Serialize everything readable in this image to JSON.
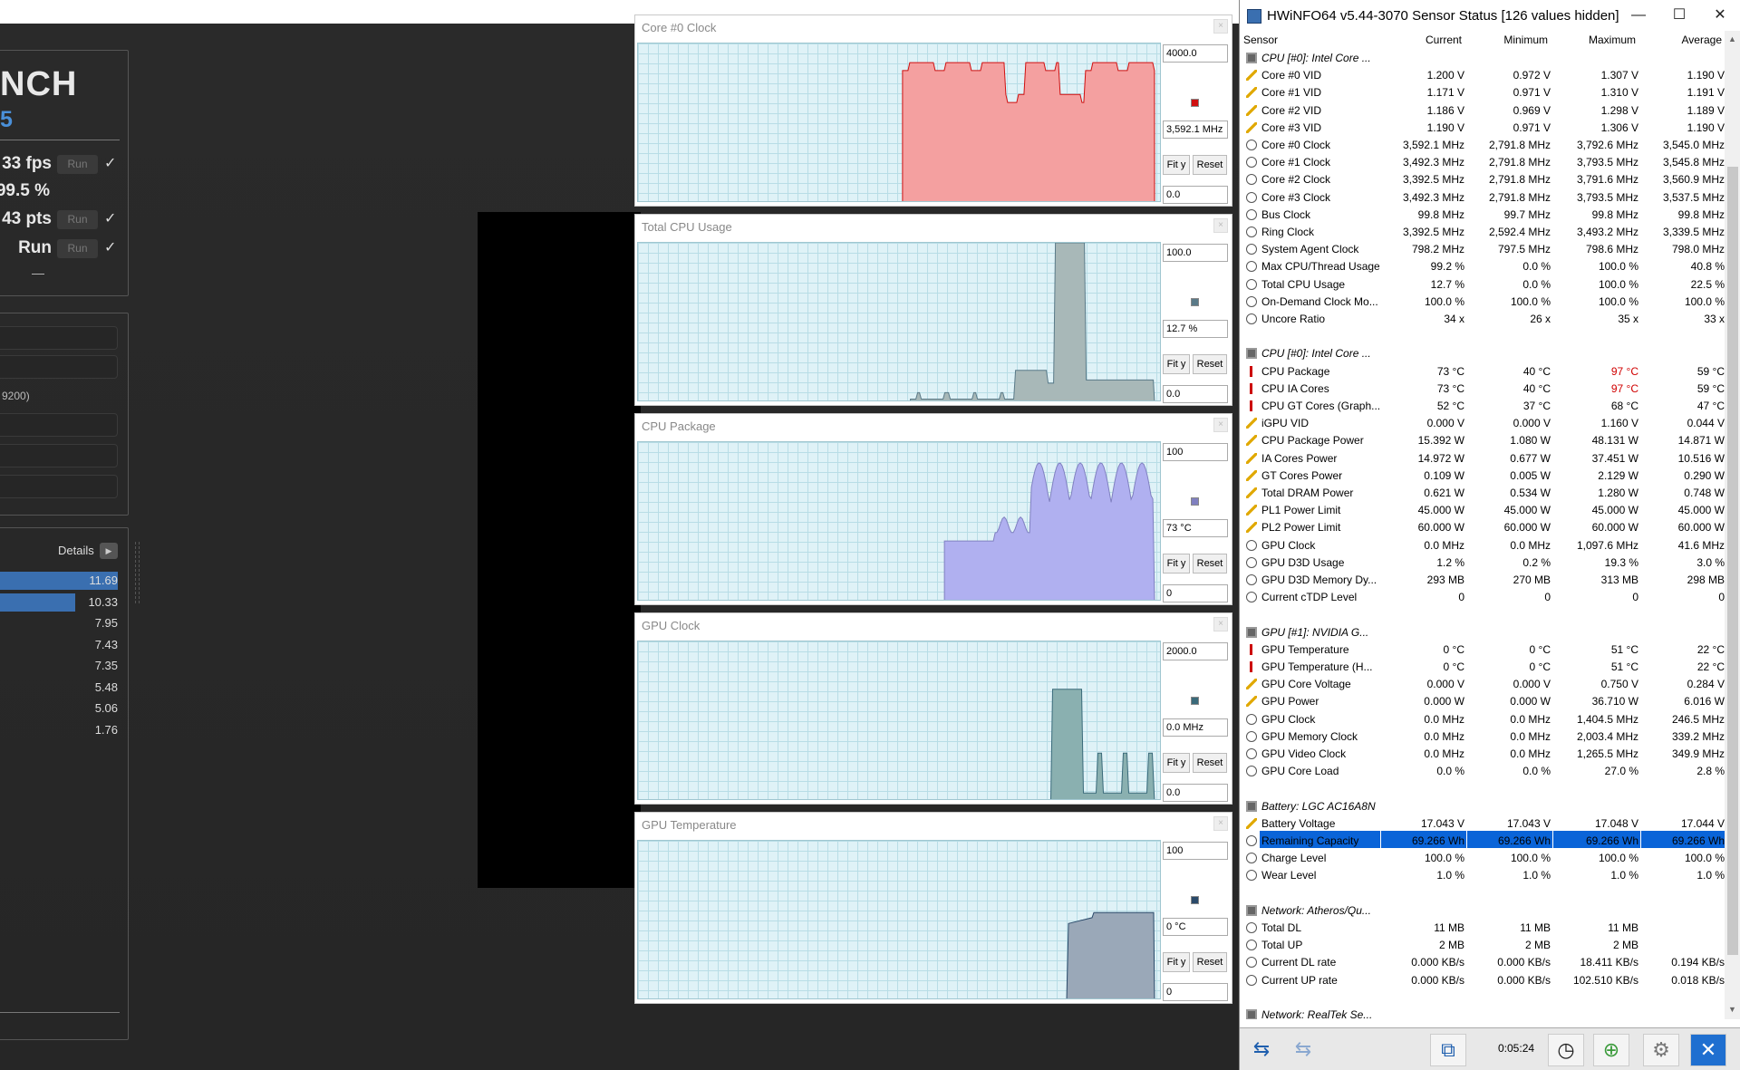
{
  "cinebench": {
    "title": "NCH",
    "subtitle": "5",
    "rows": [
      {
        "value": "33 fps",
        "run": "Run",
        "check": "✓"
      },
      {
        "value": "99.5 %",
        "run": "",
        "check": ""
      },
      {
        "value": "43 pts",
        "run": "Run",
        "check": "✓"
      },
      {
        "value": "Run",
        "run": "Run",
        "check": "✓"
      }
    ],
    "dash": "—",
    "inputs": [
      "",
      "",
      "9200)",
      "",
      "",
      ""
    ],
    "details_label": "Details",
    "ranking": [
      "11.69",
      "10.33",
      "7.95",
      "7.43",
      "7.35",
      "5.48",
      "5.06",
      "1.76"
    ],
    "ranking_fill": [
      1.0,
      0.64,
      0,
      0,
      0,
      0,
      0,
      0
    ]
  },
  "graphs": [
    {
      "title": "Core #0 Clock",
      "max": "4000.0",
      "current": "3,592.1 MHz",
      "min": "0.0",
      "color": "#f4a0a0",
      "marker": "#d01010",
      "fit": "Fit y",
      "reset": "Reset"
    },
    {
      "title": "Total CPU Usage",
      "max": "100.0",
      "current": "12.7 %",
      "min": "0.0",
      "color": "#a8b8b8",
      "marker": "#5a7a88",
      "fit": "Fit y",
      "reset": "Reset"
    },
    {
      "title": "CPU Package",
      "max": "100",
      "current": "73 °C",
      "min": "0",
      "color": "#b0b0f0",
      "marker": "#8080c0",
      "fit": "Fit y",
      "reset": "Reset"
    },
    {
      "title": "GPU Clock",
      "max": "2000.0",
      "current": "0.0 MHz",
      "min": "0.0",
      "color": "#8ab0b0",
      "marker": "#3a6a7a",
      "fit": "Fit y",
      "reset": "Reset"
    },
    {
      "title": "GPU Temperature",
      "max": "100",
      "current": "0 °C",
      "min": "0",
      "color": "#9aa8b8",
      "marker": "#2a4a6a",
      "fit": "Fit y",
      "reset": "Reset"
    }
  ],
  "hwinfo": {
    "title": "HWiNFO64 v5.44-3070 Sensor Status [126 values hidden]",
    "controls": {
      "minimize": "—",
      "maximize": "☐",
      "close": "✕"
    },
    "headers": [
      "Sensor",
      "Current",
      "Minimum",
      "Maximum",
      "Average"
    ],
    "rows": [
      {
        "t": "chip",
        "g": 1,
        "n": "CPU [#0]: Intel Core ...",
        "v": [
          "",
          "",
          "",
          ""
        ]
      },
      {
        "t": "volt",
        "n": "Core #0 VID",
        "v": [
          "1.200 V",
          "0.972 V",
          "1.307 V",
          "1.190 V"
        ]
      },
      {
        "t": "volt",
        "n": "Core #1 VID",
        "v": [
          "1.171 V",
          "0.971 V",
          "1.310 V",
          "1.191 V"
        ]
      },
      {
        "t": "volt",
        "n": "Core #2 VID",
        "v": [
          "1.186 V",
          "0.969 V",
          "1.298 V",
          "1.189 V"
        ]
      },
      {
        "t": "volt",
        "n": "Core #3 VID",
        "v": [
          "1.190 V",
          "0.971 V",
          "1.306 V",
          "1.190 V"
        ]
      },
      {
        "t": "clock",
        "n": "Core #0 Clock",
        "v": [
          "3,592.1 MHz",
          "2,791.8 MHz",
          "3,792.6 MHz",
          "3,545.0 MHz"
        ]
      },
      {
        "t": "clock",
        "n": "Core #1 Clock",
        "v": [
          "3,492.3 MHz",
          "2,791.8 MHz",
          "3,793.5 MHz",
          "3,545.8 MHz"
        ]
      },
      {
        "t": "clock",
        "n": "Core #2 Clock",
        "v": [
          "3,392.5 MHz",
          "2,791.8 MHz",
          "3,791.6 MHz",
          "3,560.9 MHz"
        ]
      },
      {
        "t": "clock",
        "n": "Core #3 Clock",
        "v": [
          "3,492.3 MHz",
          "2,791.8 MHz",
          "3,793.5 MHz",
          "3,537.5 MHz"
        ]
      },
      {
        "t": "clock",
        "n": "Bus Clock",
        "v": [
          "99.8 MHz",
          "99.7 MHz",
          "99.8 MHz",
          "99.8 MHz"
        ]
      },
      {
        "t": "clock",
        "n": "Ring Clock",
        "v": [
          "3,392.5 MHz",
          "2,592.4 MHz",
          "3,493.2 MHz",
          "3,339.5 MHz"
        ]
      },
      {
        "t": "clock",
        "n": "System Agent Clock",
        "v": [
          "798.2 MHz",
          "797.5 MHz",
          "798.6 MHz",
          "798.0 MHz"
        ]
      },
      {
        "t": "clock",
        "n": "Max CPU/Thread Usage",
        "v": [
          "99.2 %",
          "0.0 %",
          "100.0 %",
          "40.8 %"
        ]
      },
      {
        "t": "clock",
        "n": "Total CPU Usage",
        "v": [
          "12.7 %",
          "0.0 %",
          "100.0 %",
          "22.5 %"
        ]
      },
      {
        "t": "clock",
        "n": "On-Demand Clock Mo...",
        "v": [
          "100.0 %",
          "100.0 %",
          "100.0 %",
          "100.0 %"
        ]
      },
      {
        "t": "clock",
        "n": "Uncore Ratio",
        "v": [
          "34 x",
          "26 x",
          "35 x",
          "33 x"
        ]
      },
      {
        "t": "",
        "n": "",
        "v": [
          "",
          "",
          "",
          ""
        ]
      },
      {
        "t": "chip",
        "g": 1,
        "n": "CPU [#0]: Intel Core ...",
        "v": [
          "",
          "",
          "",
          ""
        ]
      },
      {
        "t": "temp",
        "n": "CPU Package",
        "v": [
          "73 °C",
          "40 °C",
          "97 °C",
          "59 °C"
        ],
        "r": 2
      },
      {
        "t": "temp",
        "n": "CPU IA Cores",
        "v": [
          "73 °C",
          "40 °C",
          "97 °C",
          "59 °C"
        ],
        "r": 2
      },
      {
        "t": "temp",
        "n": "CPU GT Cores (Graph...",
        "v": [
          "52 °C",
          "37 °C",
          "68 °C",
          "47 °C"
        ]
      },
      {
        "t": "volt",
        "n": "iGPU VID",
        "v": [
          "0.000 V",
          "0.000 V",
          "1.160 V",
          "0.044 V"
        ]
      },
      {
        "t": "volt",
        "n": "CPU Package Power",
        "v": [
          "15.392 W",
          "1.080 W",
          "48.131 W",
          "14.871 W"
        ]
      },
      {
        "t": "volt",
        "n": "IA Cores Power",
        "v": [
          "14.972 W",
          "0.677 W",
          "37.451 W",
          "10.516 W"
        ]
      },
      {
        "t": "volt",
        "n": "GT Cores Power",
        "v": [
          "0.109 W",
          "0.005 W",
          "2.129 W",
          "0.290 W"
        ]
      },
      {
        "t": "volt",
        "n": "Total DRAM Power",
        "v": [
          "0.621 W",
          "0.534 W",
          "1.280 W",
          "0.748 W"
        ]
      },
      {
        "t": "volt",
        "n": "PL1 Power Limit",
        "v": [
          "45.000 W",
          "45.000 W",
          "45.000 W",
          "45.000 W"
        ]
      },
      {
        "t": "volt",
        "n": "PL2 Power Limit",
        "v": [
          "60.000 W",
          "60.000 W",
          "60.000 W",
          "60.000 W"
        ]
      },
      {
        "t": "clock",
        "n": "GPU Clock",
        "v": [
          "0.0 MHz",
          "0.0 MHz",
          "1,097.6 MHz",
          "41.6 MHz"
        ]
      },
      {
        "t": "clock",
        "n": "GPU D3D Usage",
        "v": [
          "1.2 %",
          "0.2 %",
          "19.3 %",
          "3.0 %"
        ]
      },
      {
        "t": "clock",
        "n": "GPU D3D Memory Dy...",
        "v": [
          "293 MB",
          "270 MB",
          "313 MB",
          "298 MB"
        ]
      },
      {
        "t": "clock",
        "n": "Current cTDP Level",
        "v": [
          "0",
          "0",
          "0",
          "0"
        ]
      },
      {
        "t": "",
        "n": "",
        "v": [
          "",
          "",
          "",
          ""
        ]
      },
      {
        "t": "chip",
        "g": 1,
        "n": "GPU [#1]: NVIDIA G...",
        "v": [
          "",
          "",
          "",
          ""
        ]
      },
      {
        "t": "temp",
        "n": "GPU Temperature",
        "v": [
          "0 °C",
          "0 °C",
          "51 °C",
          "22 °C"
        ]
      },
      {
        "t": "temp",
        "n": "GPU Temperature (H...",
        "v": [
          "0 °C",
          "0 °C",
          "51 °C",
          "22 °C"
        ]
      },
      {
        "t": "volt",
        "n": "GPU Core Voltage",
        "v": [
          "0.000 V",
          "0.000 V",
          "0.750 V",
          "0.284 V"
        ]
      },
      {
        "t": "volt",
        "n": "GPU Power",
        "v": [
          "0.000 W",
          "0.000 W",
          "36.710 W",
          "6.016 W"
        ]
      },
      {
        "t": "clock",
        "n": "GPU Clock",
        "v": [
          "0.0 MHz",
          "0.0 MHz",
          "1,404.5 MHz",
          "246.5 MHz"
        ]
      },
      {
        "t": "clock",
        "n": "GPU Memory Clock",
        "v": [
          "0.0 MHz",
          "0.0 MHz",
          "2,003.4 MHz",
          "339.2 MHz"
        ]
      },
      {
        "t": "clock",
        "n": "GPU Video Clock",
        "v": [
          "0.0 MHz",
          "0.0 MHz",
          "1,265.5 MHz",
          "349.9 MHz"
        ]
      },
      {
        "t": "clock",
        "n": "GPU Core Load",
        "v": [
          "0.0 %",
          "0.0 %",
          "27.0 %",
          "2.8 %"
        ]
      },
      {
        "t": "",
        "n": "",
        "v": [
          "",
          "",
          "",
          ""
        ]
      },
      {
        "t": "chip",
        "g": 1,
        "n": "Battery: LGC AC16A8N",
        "v": [
          "",
          "",
          "",
          ""
        ]
      },
      {
        "t": "volt",
        "n": "Battery Voltage",
        "v": [
          "17.043 V",
          "17.043 V",
          "17.048 V",
          "17.044 V"
        ]
      },
      {
        "t": "clock",
        "n": "Remaining Capacity",
        "v": [
          "69.266 Wh",
          "69.266 Wh",
          "69.266 Wh",
          "69.266 Wh"
        ]
      },
      {
        "t": "clock",
        "n": "Charge Level",
        "v": [
          "100.0 %",
          "100.0 %",
          "100.0 %",
          "100.0 %"
        ]
      },
      {
        "t": "clock",
        "n": "Wear Level",
        "v": [
          "1.0 %",
          "1.0 %",
          "1.0 %",
          "1.0 %"
        ]
      },
      {
        "t": "",
        "n": "",
        "v": [
          "",
          "",
          "",
          ""
        ]
      },
      {
        "t": "chip",
        "g": 1,
        "n": "Network: Atheros/Qu...",
        "v": [
          "",
          "",
          "",
          ""
        ]
      },
      {
        "t": "clock",
        "n": "Total DL",
        "v": [
          "11 MB",
          "11 MB",
          "11 MB",
          ""
        ]
      },
      {
        "t": "clock",
        "n": "Total UP",
        "v": [
          "2 MB",
          "2 MB",
          "2 MB",
          ""
        ]
      },
      {
        "t": "clock",
        "n": "Current DL rate",
        "v": [
          "0.000 KB/s",
          "0.000 KB/s",
          "18.411 KB/s",
          "0.194 KB/s"
        ]
      },
      {
        "t": "clock",
        "n": "Current UP rate",
        "v": [
          "0.000 KB/s",
          "0.000 KB/s",
          "102.510 KB/s",
          "0.018 KB/s"
        ]
      },
      {
        "t": "",
        "n": "",
        "v": [
          "",
          "",
          "",
          ""
        ]
      },
      {
        "t": "chip",
        "g": 1,
        "n": "Network: RealTek Se...",
        "v": [
          "",
          "",
          "",
          ""
        ]
      }
    ],
    "elapsed": "0:05:24",
    "status_icons": [
      "back-arrows-icon",
      "forward-arrows-icon",
      "network-icon",
      "clock-icon",
      "report-add-icon",
      "settings-icon",
      "close-icon"
    ]
  }
}
